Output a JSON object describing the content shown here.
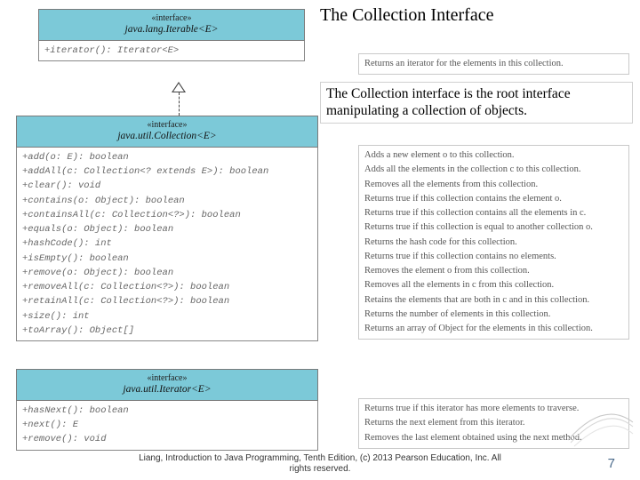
{
  "title": "The Collection Interface",
  "subtitle": "The Collection interface is the root interface manipulating a collection of objects.",
  "iterable": {
    "stereo": "«interface»",
    "name": "java.lang.Iterable<E>",
    "methods": [
      "+iterator(): Iterator<E>"
    ],
    "descs": [
      "Returns an iterator for the elements in this collection."
    ]
  },
  "collection": {
    "stereo": "«interface»",
    "name": "java.util.Collection<E>",
    "methods": [
      "+add(o: E): boolean",
      "+addAll(c: Collection<? extends E>): boolean",
      "+clear(): void",
      "+contains(o: Object): boolean",
      "+containsAll(c: Collection<?>): boolean",
      "+equals(o: Object): boolean",
      "+hashCode(): int",
      "+isEmpty(): boolean",
      "+remove(o: Object): boolean",
      "+removeAll(c: Collection<?>): boolean",
      "+retainAll(c: Collection<?>): boolean",
      "+size(): int",
      "+toArray(): Object[]"
    ],
    "descs": [
      "Adds a new element o to this collection.",
      "Adds all the elements in the collection c to this collection.",
      "Removes all the elements from this collection.",
      "Returns true if this collection contains the element o.",
      "Returns true if this collection contains all the elements in c.",
      "Returns true if this collection is equal to another collection o.",
      "Returns the hash code for this collection.",
      "Returns true if this collection contains no elements.",
      "Removes the element o from this collection.",
      "Removes all the elements in c from this collection.",
      "Retains the elements that are both in c and in this collection.",
      "Returns the number of elements in this collection.",
      "Returns an array of Object for the elements in this collection."
    ]
  },
  "iterator": {
    "stereo": "«interface»",
    "name": "java.util.Iterator<E>",
    "methods": [
      "+hasNext(): boolean",
      "+next(): E",
      "+remove(): void"
    ],
    "descs": [
      "Returns true if this iterator has more elements to traverse.",
      "Returns the next element from this iterator.",
      "Removes the last element obtained using the next method."
    ]
  },
  "footer": {
    "line1": "Liang, Introduction to Java Programming, Tenth Edition, (c) 2013 Pearson Education, Inc. All",
    "line2": "rights reserved."
  },
  "page": "7"
}
